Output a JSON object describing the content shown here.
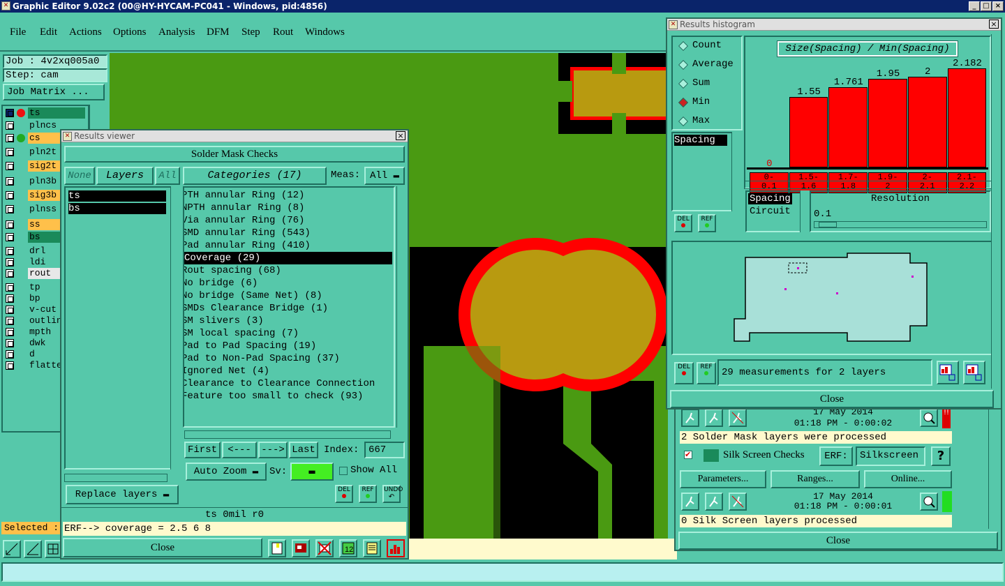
{
  "app": {
    "title": "Graphic Editor 9.02c2 (00@HY-HYCAM-PC041 - Windows, pid:4856)"
  },
  "menu": [
    "File",
    "Edit",
    "Actions",
    "Options",
    "Analysis",
    "DFM",
    "Step",
    "Rout",
    "Windows"
  ],
  "job": {
    "job_label": "Job : 4v2xq005a0",
    "step_label": "Step: cam",
    "matrix_button": "Job Matrix ..."
  },
  "layers": [
    {
      "name": "ts",
      "color": "#1a8a5a",
      "active": true
    },
    {
      "name": "plncs",
      "color": "#56c8aa"
    },
    {
      "name": "cs",
      "color": "#ffc04a"
    },
    {
      "name": "pln2t",
      "color": "#56c8aa"
    },
    {
      "name": "sig2t",
      "color": "#ffc04a"
    },
    {
      "name": "pln3b",
      "color": "#56c8aa"
    },
    {
      "name": "sig3b",
      "color": "#ffc04a"
    },
    {
      "name": "plnss",
      "color": "#56c8aa"
    },
    {
      "name": "ss",
      "color": "#ffc04a"
    },
    {
      "name": "bs",
      "color": "#1a8a5a"
    },
    {
      "name": "drl",
      "color": "#56c8aa"
    },
    {
      "name": "ldi",
      "color": "#56c8aa"
    },
    {
      "name": "rout",
      "color": "#e8e8e8"
    },
    {
      "name": "tp",
      "color": "#56c8aa"
    },
    {
      "name": "bp",
      "color": "#56c8aa"
    },
    {
      "name": "v-cut",
      "color": "#56c8aa"
    },
    {
      "name": "outlin",
      "color": "#56c8aa"
    },
    {
      "name": "mpth",
      "color": "#56c8aa"
    },
    {
      "name": "dwk",
      "color": "#56c8aa"
    },
    {
      "name": "d",
      "color": "#56c8aa"
    },
    {
      "name": "flatte",
      "color": "#56c8aa"
    }
  ],
  "selected_label": "Selected :",
  "viewer": {
    "title": "Results viewer",
    "heading": "Solder Mask Checks",
    "none_btn": "None",
    "layers_btn": "Layers",
    "all_btn": "All",
    "categories_btn": "Categories (17)",
    "meas_label": "Meas:",
    "meas_value": "All",
    "layer_list": [
      "ts",
      "bs"
    ],
    "categories": [
      "PTH annular Ring (12)",
      "NPTH annular Ring (8)",
      "Via annular Ring (76)",
      "SMD annular Ring (543)",
      "Pad annular Ring (410)",
      "Coverage (29)",
      "Rout spacing (68)",
      "No bridge (6)",
      "No bridge (Same Net) (8)",
      "SMDs Clearance Bridge (1)",
      "SM slivers (3)",
      "SM local spacing (7)",
      "Pad to Pad Spacing (19)",
      "Pad to Non-Pad Spacing (37)",
      "Ignored Net (4)",
      "Clearance to Clearance Connection",
      "Feature too small to check (93)"
    ],
    "nav": {
      "first": "First",
      "prev": "<---",
      "next": "--->",
      "last": "Last",
      "index_label": "Index:",
      "index_value": "667"
    },
    "auto_zoom": "Auto Zoom",
    "sv_label": "Sv:",
    "show_all": "Show All",
    "replace_layers": "Replace layers",
    "status_line": "ts 0mil  r0",
    "erf_line": "ERF--> coverage = 2.5 6 8",
    "close": "Close",
    "del": "DEL",
    "ref": "REF",
    "undo": "UNDO"
  },
  "histogram": {
    "title": "Results histogram",
    "modes": [
      "Count",
      "Average",
      "Sum",
      "Min",
      "Max"
    ],
    "selected_mode": "Min",
    "chart_title": "Size(Spacing) / Min(Spacing)",
    "measure_list": [
      "Spacing"
    ],
    "sort_list": [
      "Spacing",
      "Circuit"
    ],
    "resolution_label": "Resolution",
    "resolution_value": "0.1",
    "summary": "29 measurements for 2 layers",
    "close": "Close"
  },
  "chart_data": {
    "type": "bar",
    "title": "Size(Spacing) / Min(Spacing)",
    "categories": [
      "0-\n0.1",
      "1.5-\n1.6",
      "1.7-\n1.8",
      "1.9-\n2",
      "2-\n2.1",
      "2.1-\n2.2"
    ],
    "values": [
      0,
      1.55,
      1.761,
      1.95,
      2,
      2.182
    ],
    "value_labels": [
      "0",
      "1.55",
      "1.761",
      "1.95",
      "2",
      "2.182"
    ],
    "ylim": [
      0,
      2.3
    ]
  },
  "dfm": {
    "row1_date": "17 May 2014",
    "row1_time": "01:18 PM - 0:00:02",
    "row1_status": "2 Solder Mask layers were processed",
    "silk_title": "Silk Screen Checks",
    "erf_label": "ERF:",
    "erf_value": "Silkscreen",
    "help": "?",
    "parameters": "Parameters...",
    "ranges": "Ranges...",
    "online": "Online...",
    "row2_date": "17 May 2014",
    "row2_time": "01:18 PM - 0:00:01",
    "row2_status": "0 Silk Screen layers processed",
    "close": "Close"
  }
}
